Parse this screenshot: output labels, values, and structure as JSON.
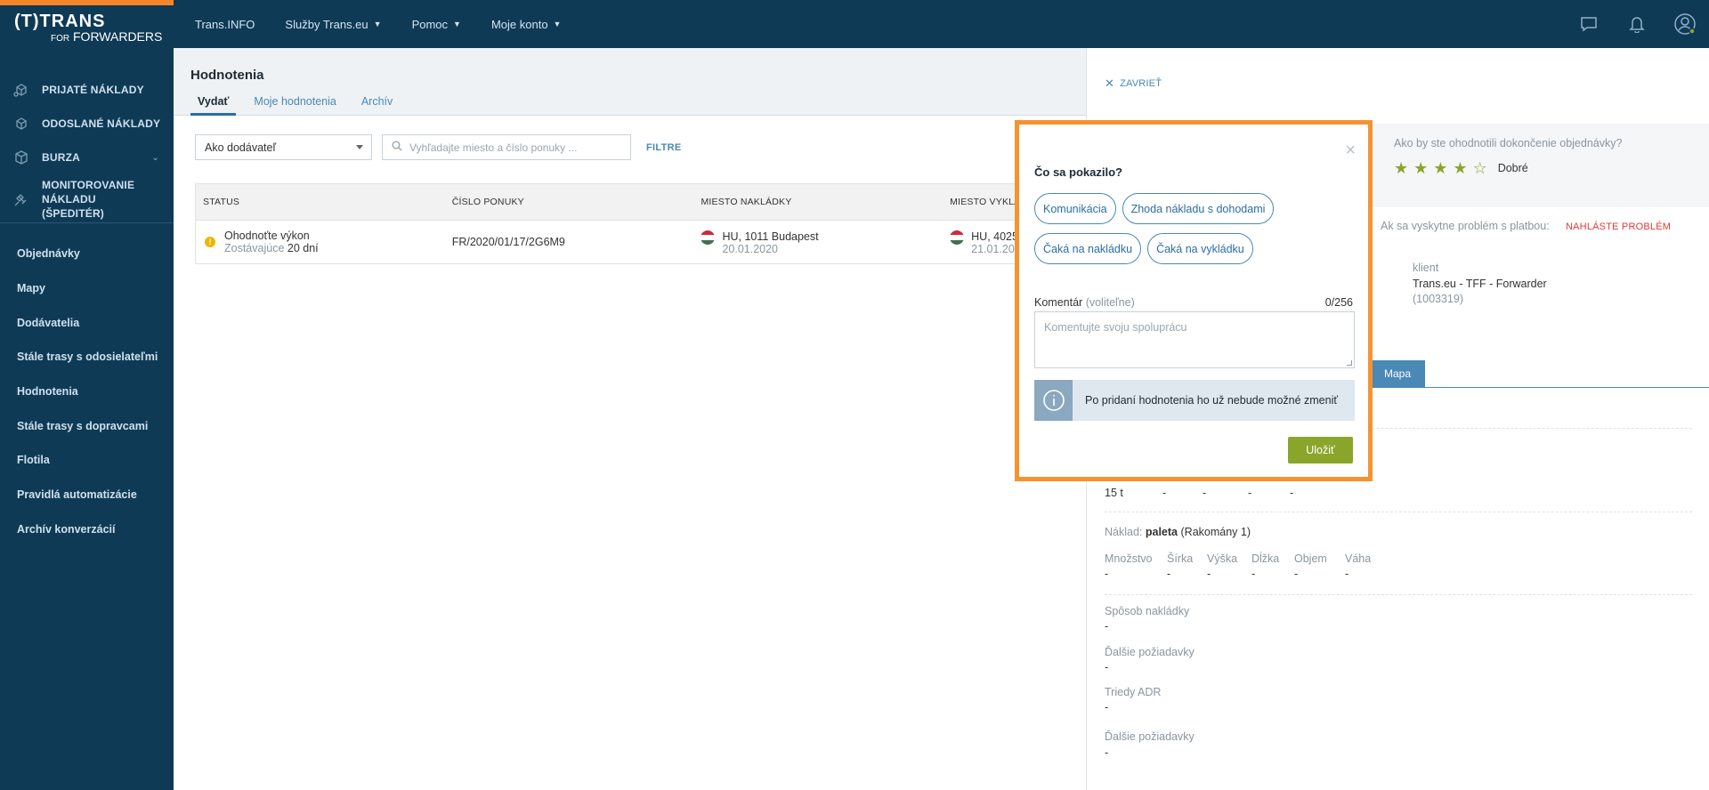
{
  "brand": {
    "line1": "(T)TRANS",
    "line2_prefix": "FOR",
    "line2_main": "FORWARDERS"
  },
  "sidebar": {
    "main_items": [
      {
        "label": "PRIJATÉ NÁKLADY"
      },
      {
        "label": "ODOSLANÉ NÁKLADY"
      },
      {
        "label": "BURZA"
      },
      {
        "label": "MONITOROVANIE NÁKLADU (ŠPEDITÉR)"
      }
    ],
    "sub_items": [
      {
        "label": "Objednávky"
      },
      {
        "label": "Mapy"
      },
      {
        "label": "Dodávatelia"
      },
      {
        "label": "Stále trasy s odosielateľmi"
      },
      {
        "label": "Hodnotenia"
      },
      {
        "label": "Stále trasy s dopravcami"
      },
      {
        "label": "Flotila"
      },
      {
        "label": "Pravidlá automatizácie"
      },
      {
        "label": "Archív konverzácií"
      }
    ]
  },
  "topbar": {
    "nav": [
      {
        "label": "Trans.INFO"
      },
      {
        "label": "Služby Trans.eu"
      },
      {
        "label": "Pomoc"
      },
      {
        "label": "Moje konto"
      }
    ]
  },
  "page": {
    "title": "Hodnotenia",
    "tabs": [
      {
        "label": "Vydať"
      },
      {
        "label": "Moje hodnotenia"
      },
      {
        "label": "Archív"
      }
    ],
    "filter_select": "Ako dodávateľ",
    "search_placeholder": "Vyhľadajte miesto a číslo ponuky ...",
    "filter_link": "FILTRE"
  },
  "table": {
    "headers": [
      "STATUS",
      "ČÍSLO PONUKY",
      "MIESTO NAKLÁDKY",
      "MIESTO VYKLÁDKY"
    ],
    "rows": [
      {
        "status": "Ohodnoťte výkon",
        "remaining_label": "Zostávajúce",
        "remaining_value": "20 dní",
        "offer": "FR/2020/01/17/2G6M9",
        "load_place": "HU, 1011 Budapest",
        "load_date": "20.01.2020",
        "unload_place": "HU, 4025",
        "unload_date": "21.01.20"
      }
    ]
  },
  "panel": {
    "close_label": "ZAVRIEŤ",
    "rating_question": "Ako by ste ohodnotili dokončenie objednávky?",
    "rating_stars": 4,
    "rating_max": 5,
    "rating_label": "Dobré",
    "payment_question": "Ak sa vyskytne problém s platbou:",
    "payment_link": "NAHLÁSTE PROBLÉM",
    "client_label": "klient",
    "client_name": "Trans.eu - TFF - Forwarder",
    "client_id": "(1003319)",
    "map_tab": "Mapa",
    "weight_value": "15 t",
    "dash": "-",
    "cargo_label": "Náklad:",
    "cargo_type": "paleta",
    "cargo_extra": "(Rakomány 1)",
    "cargo_cols": [
      "Množstvo",
      "Šírka",
      "Výška",
      "Dĺžka",
      "Objem",
      "Váha"
    ],
    "loading_method_label": "Spôsob nakládky",
    "extra_req_label": "Ďalšie požiadavky",
    "adr_label": "Triedy ADR",
    "extra_req_label2": "Ďalšie požiadavky"
  },
  "modal": {
    "title": "Čo sa pokazilo?",
    "chips": [
      {
        "label": "Komunikácia"
      },
      {
        "label": "Zhoda nákladu s dohodami"
      },
      {
        "label": "Čaká na nakládku"
      },
      {
        "label": "Čaká na vykládku"
      }
    ],
    "comment_label": "Komentár",
    "comment_optional": "(voliteľne)",
    "counter": "0/256",
    "comment_placeholder": "Komentujte svoju spoluprácu",
    "info_text": "Po pridaní hodnotenia ho už nebude možné zmeniť",
    "save_label": "Uložiť"
  },
  "colors": {
    "sidebar_bg": "#0f3a56",
    "accent_orange": "#f5932f",
    "link_blue": "#4a88b6",
    "save_green": "#8aa52a",
    "danger_red": "#e53935"
  }
}
